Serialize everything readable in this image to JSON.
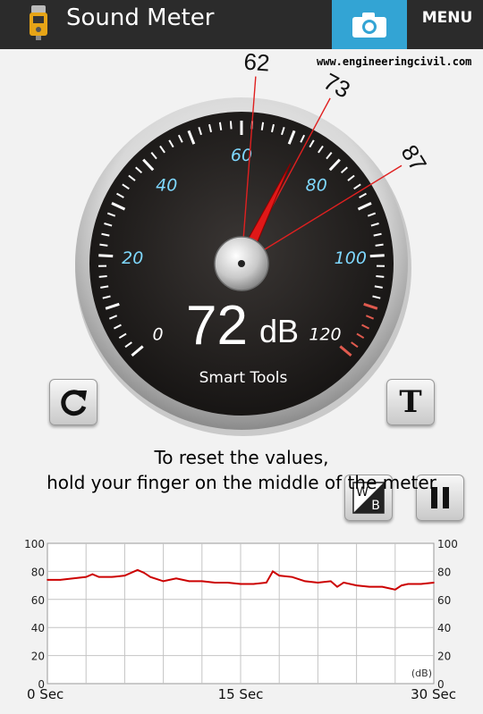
{
  "app": {
    "title": "Sound Meter",
    "menu_label": "MENU",
    "website": "www.engineeringcivil.com"
  },
  "gauge": {
    "scale_labels": [
      "0",
      "20",
      "40",
      "60",
      "80",
      "100",
      "120"
    ],
    "scale_min": 0,
    "scale_max": 120,
    "current_db": 72,
    "reading_text": "72",
    "unit": "dB",
    "brand": "Smart Tools",
    "markers": [
      {
        "label": "62",
        "value": 62
      },
      {
        "label": "73",
        "value": 73
      },
      {
        "label": "87",
        "value": 87
      }
    ]
  },
  "controls": {
    "text_button_label": "T",
    "wb_top": "W",
    "wb_bottom": "B"
  },
  "hint": {
    "line1": "To reset the values,",
    "line2": "hold your finger on the middle of the meter"
  },
  "chart_data": {
    "type": "line",
    "xlabel_ticks": [
      "0 Sec",
      "15 Sec",
      "30 Sec"
    ],
    "y_ticks": [
      "0",
      "20",
      "40",
      "60",
      "80",
      "100"
    ],
    "unit_label": "(dB)",
    "ylim": [
      0,
      100
    ],
    "xlim": [
      0,
      30
    ],
    "grid": true,
    "series": [
      {
        "color": "#cc0000",
        "x": [
          0,
          1,
          2,
          3,
          3.5,
          4,
          5,
          6,
          7,
          7.5,
          8,
          9,
          10,
          11,
          12,
          13,
          14,
          15,
          16,
          17,
          17.5,
          18,
          19,
          20,
          21,
          22,
          22.5,
          23,
          24,
          25,
          26,
          27,
          27.5,
          28,
          29,
          30
        ],
        "y": [
          74,
          74,
          75,
          76,
          78,
          76,
          76,
          77,
          81,
          79,
          76,
          73,
          75,
          73,
          73,
          72,
          72,
          71,
          71,
          72,
          80,
          77,
          76,
          73,
          72,
          73,
          69,
          72,
          70,
          69,
          69,
          67,
          70,
          71,
          71,
          72
        ]
      }
    ]
  }
}
